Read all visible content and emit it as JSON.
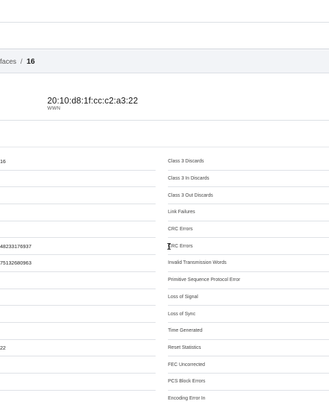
{
  "breadcrumb": {
    "parent": "faces",
    "separator": "/",
    "current": "16"
  },
  "summary": {
    "wwn_value": "20:10:d8:1f:cc:c2:a3:22",
    "wwn_label": "WWN"
  },
  "left_values": [
    "16",
    "",
    "",
    "",
    "",
    "48233176937",
    "75132680963",
    "",
    "",
    "",
    "",
    "22",
    "",
    "",
    ""
  ],
  "right_labels": [
    "Class 3 Discards",
    "Class 3 In Discards",
    "Class 3 Out Discards",
    "Link Failures",
    "CRC Errors",
    "CRC Errors",
    "Invalid Transmission Words",
    "Primitive Sequence Protocol Error",
    "Loss of Signal",
    "Loss of Sync",
    "Time Generated",
    "Reset Statistics",
    "FEC Uncorrected",
    "PCS Block Errors",
    "Encoding Error In"
  ],
  "cursor": {
    "glyph": "I"
  }
}
